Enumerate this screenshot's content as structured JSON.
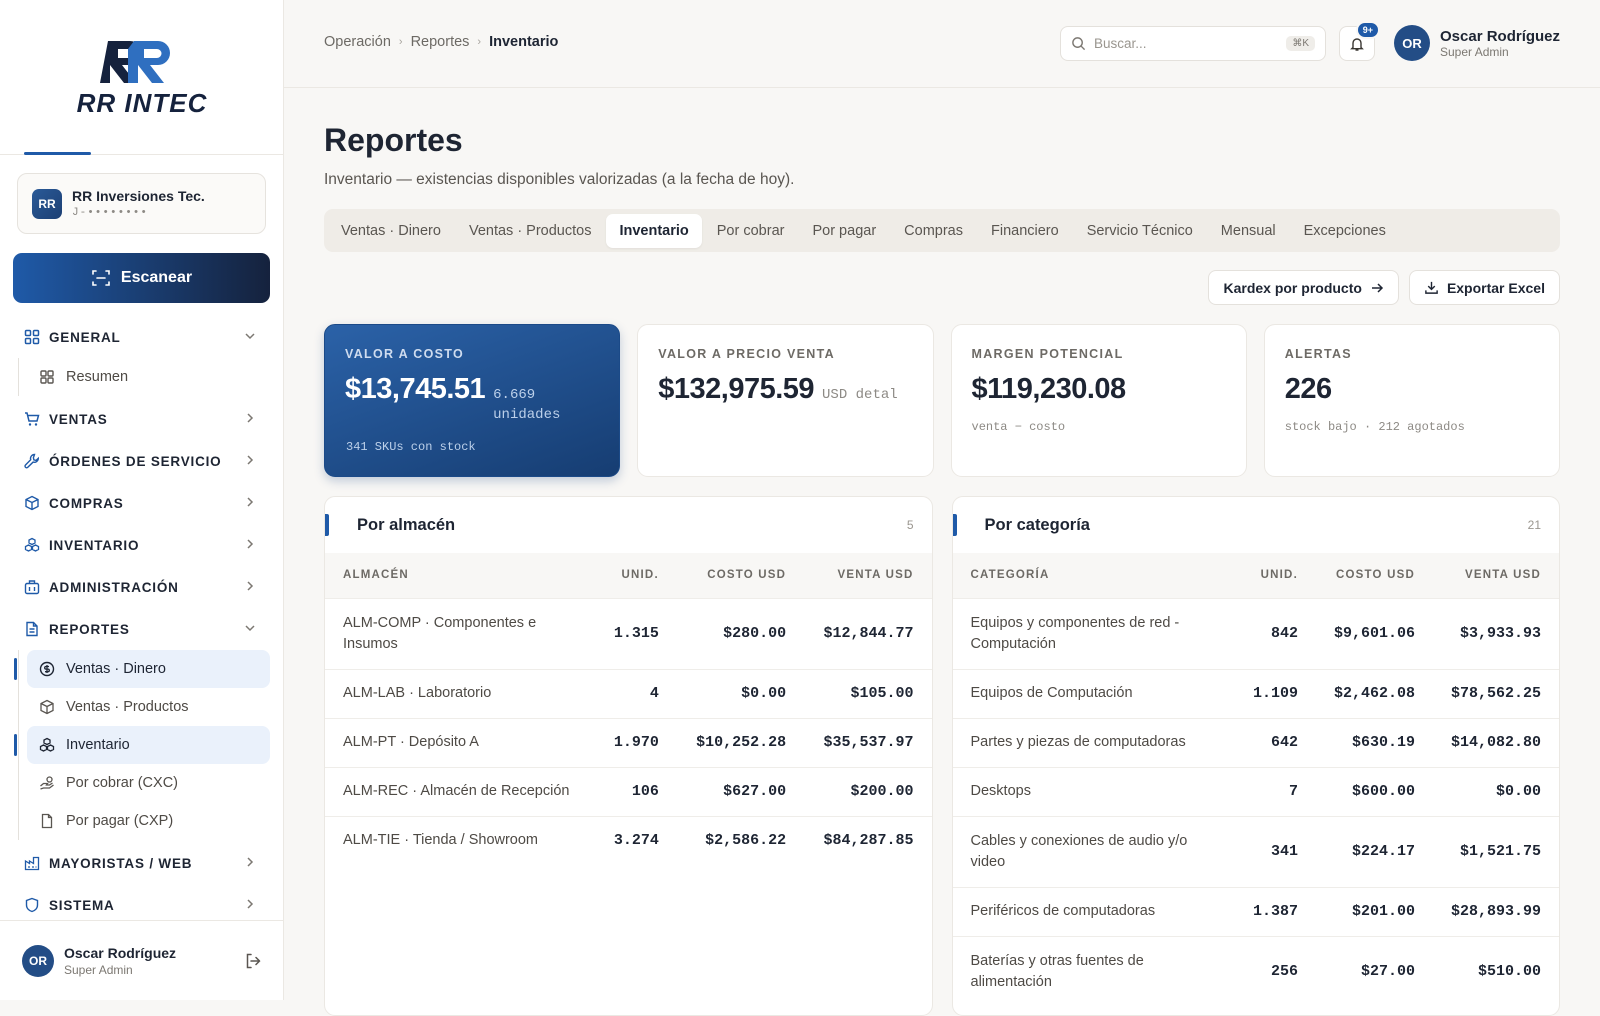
{
  "brand": {
    "logo_text": "RR INTEC",
    "accent": "#1f5aa8"
  },
  "company": {
    "badge": "RR",
    "name": "RR Inversiones Tec.",
    "id": "J-••••••••"
  },
  "scan_label": "Escanear",
  "nav": {
    "general": "GENERAL",
    "resumen": "Resumen",
    "ventas": "VENTAS",
    "ordenes": "ÓRDENES DE SERVICIO",
    "compras": "COMPRAS",
    "inventario": "INVENTARIO",
    "administracion": "ADMINISTRACIÓN",
    "reportes": "REPORTES",
    "reportes_items": [
      "Ventas · Dinero",
      "Ventas · Productos",
      "Inventario",
      "Por cobrar (CXC)",
      "Por pagar (CXP)"
    ],
    "mayoristas": "MAYORISTAS / WEB",
    "sistema": "SISTEMA"
  },
  "user": {
    "initials": "OR",
    "name": "Oscar Rodríguez",
    "role": "Super Admin"
  },
  "breadcrumb": [
    "Operación",
    "Reportes",
    "Inventario"
  ],
  "search": {
    "placeholder": "Buscar...",
    "shortcut": "⌘K"
  },
  "notifications": {
    "badge": "9+"
  },
  "page": {
    "title": "Reportes",
    "subtitle": "Inventario — existencias disponibles valorizadas (a la fecha de hoy)."
  },
  "tabs": [
    "Ventas · Dinero",
    "Ventas · Productos",
    "Inventario",
    "Por cobrar",
    "Por pagar",
    "Compras",
    "Financiero",
    "Servicio Técnico",
    "Mensual",
    "Excepciones"
  ],
  "actions": {
    "kardex": "Kardex por producto",
    "export": "Exportar Excel"
  },
  "kpis": [
    {
      "label": "VALOR A COSTO",
      "value": "$13,745.51",
      "unit": "6.669 unidades",
      "foot": "341 SKUs con stock"
    },
    {
      "label": "VALOR A PRECIO VENTA",
      "value": "$132,975.59",
      "unit": "USD detal",
      "foot": ""
    },
    {
      "label": "MARGEN POTENCIAL",
      "value": "$119,230.08",
      "unit": "",
      "foot": "venta − costo"
    },
    {
      "label": "ALERTAS",
      "value": "226",
      "unit": "",
      "foot": "stock bajo · 212 agotados"
    }
  ],
  "almacen": {
    "title": "Por almacén",
    "count": "5",
    "columns": [
      "ALMACÉN",
      "UNID.",
      "COSTO USD",
      "VENTA USD"
    ],
    "rows": [
      [
        "ALM-COMP · Componentes e Insumos",
        "1.315",
        "$280.00",
        "$12,844.77"
      ],
      [
        "ALM-LAB · Laboratorio",
        "4",
        "$0.00",
        "$105.00"
      ],
      [
        "ALM-PT · Depósito A",
        "1.970",
        "$10,252.28",
        "$35,537.97"
      ],
      [
        "ALM-REC · Almacén de Recepción",
        "106",
        "$627.00",
        "$200.00"
      ],
      [
        "ALM-TIE · Tienda / Showroom",
        "3.274",
        "$2,586.22",
        "$84,287.85"
      ]
    ]
  },
  "categoria": {
    "title": "Por categoría",
    "count": "21",
    "columns": [
      "CATEGORÍA",
      "UNID.",
      "COSTO USD",
      "VENTA USD"
    ],
    "rows": [
      [
        "Equipos y componentes de red - Computación",
        "842",
        "$9,601.06",
        "$3,933.93"
      ],
      [
        "Equipos de Computación",
        "1.109",
        "$2,462.08",
        "$78,562.25"
      ],
      [
        "Partes y piezas de computadoras",
        "642",
        "$630.19",
        "$14,082.80"
      ],
      [
        "Desktops",
        "7",
        "$600.00",
        "$0.00"
      ],
      [
        "Cables y conexiones de audio y/o video",
        "341",
        "$224.17",
        "$1,521.75"
      ],
      [
        "Periféricos de computadoras",
        "1.387",
        "$201.00",
        "$28,893.99"
      ],
      [
        "Baterías y otras fuentes de alimentación",
        "256",
        "$27.00",
        "$510.00"
      ]
    ]
  }
}
